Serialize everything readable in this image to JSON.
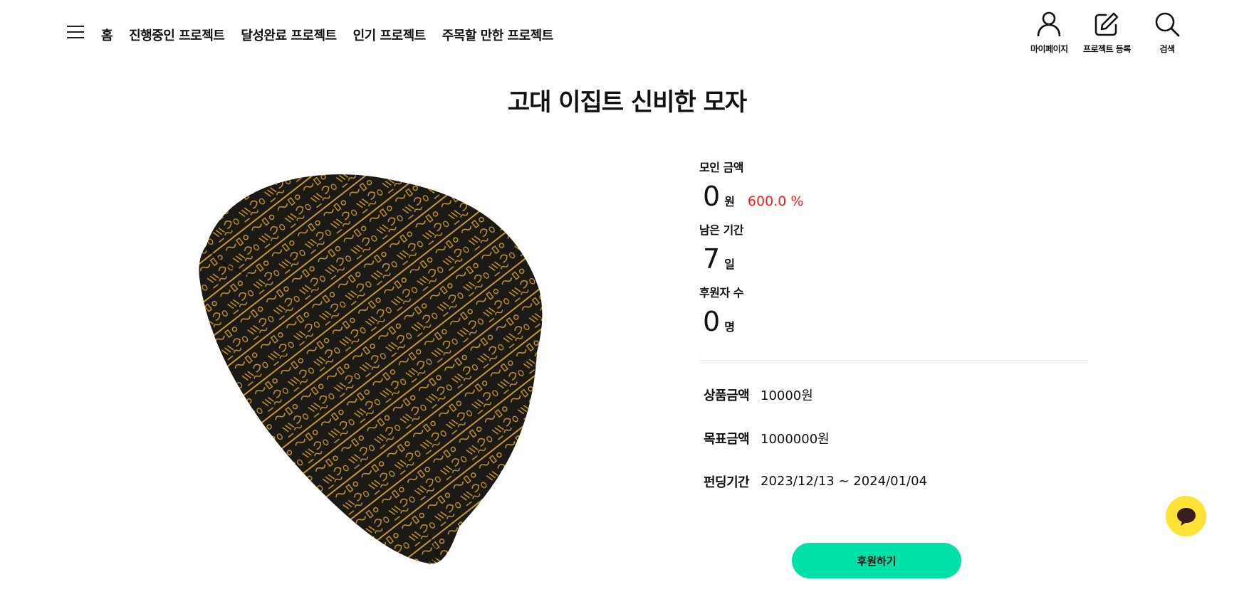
{
  "nav": {
    "items": [
      "홈",
      "진행중인 프로젝트",
      "달성완료 프로젝트",
      "인기 프로젝트",
      "주목할 만한 프로젝트"
    ]
  },
  "utilities": {
    "mypage": "마이페이지",
    "register": "프로젝트 등록",
    "search": "검색"
  },
  "project": {
    "title": "고대 이집트 신비한 모자",
    "raised_label": "모인 금액",
    "raised_value": "0",
    "raised_unit": "원",
    "raised_percent": "600.0 %",
    "remaining_label": "남은 기간",
    "remaining_value": "7",
    "remaining_unit": "일",
    "backers_label": "후원자 수",
    "backers_value": "0",
    "backers_unit": "명",
    "details": [
      {
        "key": "상품금액",
        "value": "10000원"
      },
      {
        "key": "목표금액",
        "value": "1000000원"
      },
      {
        "key": "펀딩기간",
        "value": "2023/12/13 ~ 2024/01/04"
      }
    ],
    "fund_button": "후원하기"
  },
  "colors": {
    "accent": "#00e0a8",
    "percent": "#ff1a1a",
    "chat": "#fee234",
    "hat_base": "#1c1a17",
    "hat_pattern": "#c9962f"
  },
  "icons": [
    "menu-icon",
    "user-icon",
    "edit-icon",
    "search-icon",
    "chat-icon"
  ]
}
